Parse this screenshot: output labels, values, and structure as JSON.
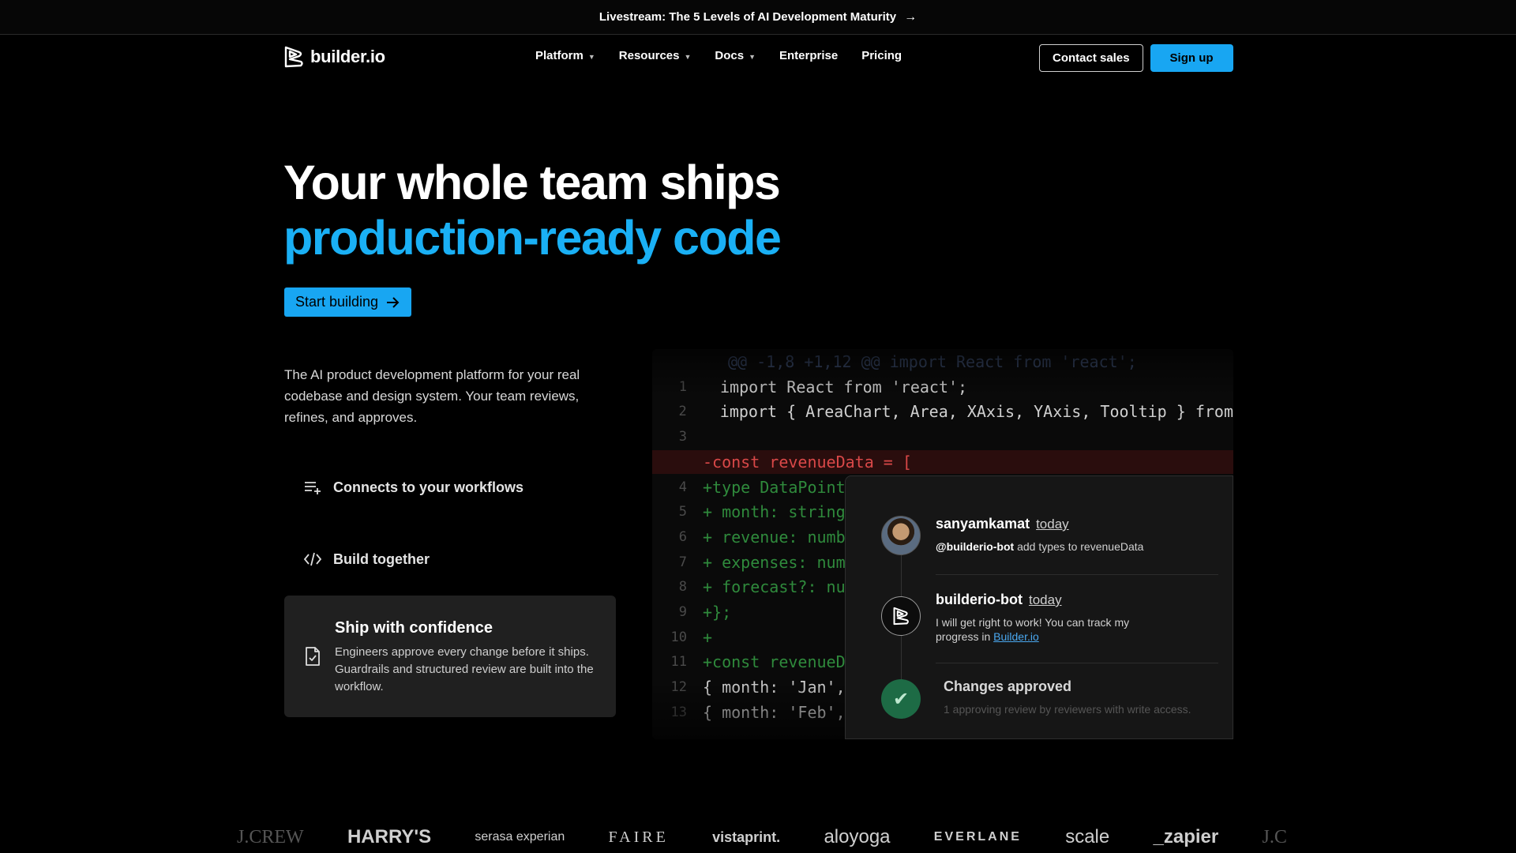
{
  "banner": {
    "text": "Livestream: The 5 Levels of AI Development Maturity",
    "arrow": "→"
  },
  "nav": {
    "logo": "builder.io",
    "menu": [
      {
        "label": "Platform",
        "dropdown": true
      },
      {
        "label": "Resources",
        "dropdown": true
      },
      {
        "label": "Docs",
        "dropdown": true
      },
      {
        "label": "Enterprise",
        "dropdown": false
      },
      {
        "label": "Pricing",
        "dropdown": false
      }
    ],
    "contact_label": "Contact sales",
    "signup_label": "Sign up"
  },
  "hero": {
    "line1": "Your whole team ships",
    "line2": "production-ready code",
    "cta": "Start building",
    "description": "The AI product development platform for your real codebase and design system. Your team reviews, refines, and approves."
  },
  "features": {
    "item1": "Connects to your workflows",
    "item2": "Build together",
    "card_title": "Ship with confidence",
    "card_body": "Engineers approve every change before it ships. Guardrails and structured review are built into the workflow."
  },
  "code": {
    "lines": [
      {
        "ln": "",
        "text": "@@ -1,8 +1,12 @@ import React from 'react';",
        "kind": "hunk"
      },
      {
        "ln": "1",
        "text": "import React from 'react';",
        "kind": "ctx"
      },
      {
        "ln": "2",
        "text": "import { AreaChart, Area, XAxis, YAxis, Tooltip } from",
        "kind": "ctx"
      },
      {
        "ln": "3",
        "text": "",
        "kind": "ctx"
      },
      {
        "ln": "",
        "text": "-const revenueData = [",
        "kind": "del"
      },
      {
        "ln": "4",
        "text": "+type DataPoint",
        "kind": "add"
      },
      {
        "ln": "5",
        "text": "+ month: string",
        "kind": "add"
      },
      {
        "ln": "6",
        "text": "+ revenue: numb",
        "kind": "add"
      },
      {
        "ln": "7",
        "text": "+ expenses: num",
        "kind": "add"
      },
      {
        "ln": "8",
        "text": "+ forecast?: nu",
        "kind": "add"
      },
      {
        "ln": "9",
        "text": "+};",
        "kind": "add"
      },
      {
        "ln": "10",
        "text": "+",
        "kind": "add"
      },
      {
        "ln": "11",
        "text": "+const revenueD",
        "kind": "add"
      },
      {
        "ln": "12",
        "text": "{ month: 'Jan',",
        "kind": "ctx"
      },
      {
        "ln": "13",
        "text": "{ month: 'Feb',",
        "kind": "ctx"
      }
    ]
  },
  "comments": {
    "user1": "sanyamkamat",
    "time1": "today",
    "mention": "@builderio-bot",
    "msg1": " add types to revenueData",
    "user2": "builderio-bot",
    "time2": "today",
    "msg2": "I will get right to work! You can track my progress in ",
    "link": "Builder.io",
    "approved": "Changes approved",
    "approved_sub": "1 approving review by reviewers with write access."
  },
  "logos": [
    "J.CREW",
    "HARRY'S",
    "serasa experian",
    "FAIRE",
    "vistaprint.",
    "aloyoga",
    "EVERLANE",
    "scale",
    "_zapier",
    "J.C"
  ]
}
